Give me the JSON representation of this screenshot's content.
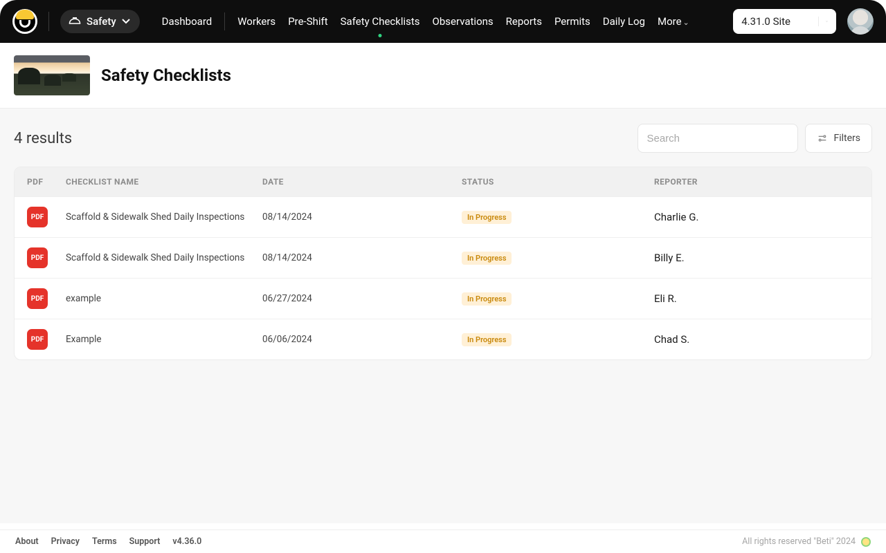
{
  "nav": {
    "module_label": "Safety",
    "links": [
      "Dashboard",
      "Workers",
      "Pre-Shift",
      "Safety Checklists",
      "Observations",
      "Reports",
      "Permits",
      "Daily Log",
      "More"
    ],
    "active_index": 3,
    "site_select_value": "4.31.0 Site"
  },
  "header": {
    "title": "Safety Checklists"
  },
  "results": {
    "count_text": "4 results",
    "search_placeholder": "Search",
    "filters_label": "Filters"
  },
  "table": {
    "columns": {
      "pdf": "PDF",
      "name": "CHECKLIST NAME",
      "date": "DATE",
      "status": "STATUS",
      "reporter": "REPORTER"
    },
    "rows": [
      {
        "pdf": "PDF",
        "name": "Scaffold & Sidewalk Shed Daily Inspections",
        "date": "08/14/2024",
        "status": "In Progress",
        "reporter": "Charlie G."
      },
      {
        "pdf": "PDF",
        "name": "Scaffold & Sidewalk Shed Daily Inspections",
        "date": "08/14/2024",
        "status": "In Progress",
        "reporter": "Billy E."
      },
      {
        "pdf": "PDF",
        "name": "example",
        "date": "06/27/2024",
        "status": "In Progress",
        "reporter": "Eli R."
      },
      {
        "pdf": "PDF",
        "name": "Example",
        "date": "06/06/2024",
        "status": "In Progress",
        "reporter": "Chad S."
      }
    ]
  },
  "footer": {
    "links": [
      "About",
      "Privacy",
      "Terms",
      "Support"
    ],
    "version": "v4.36.0",
    "copyright": "All rights reserved \"Beti\" 2024"
  }
}
